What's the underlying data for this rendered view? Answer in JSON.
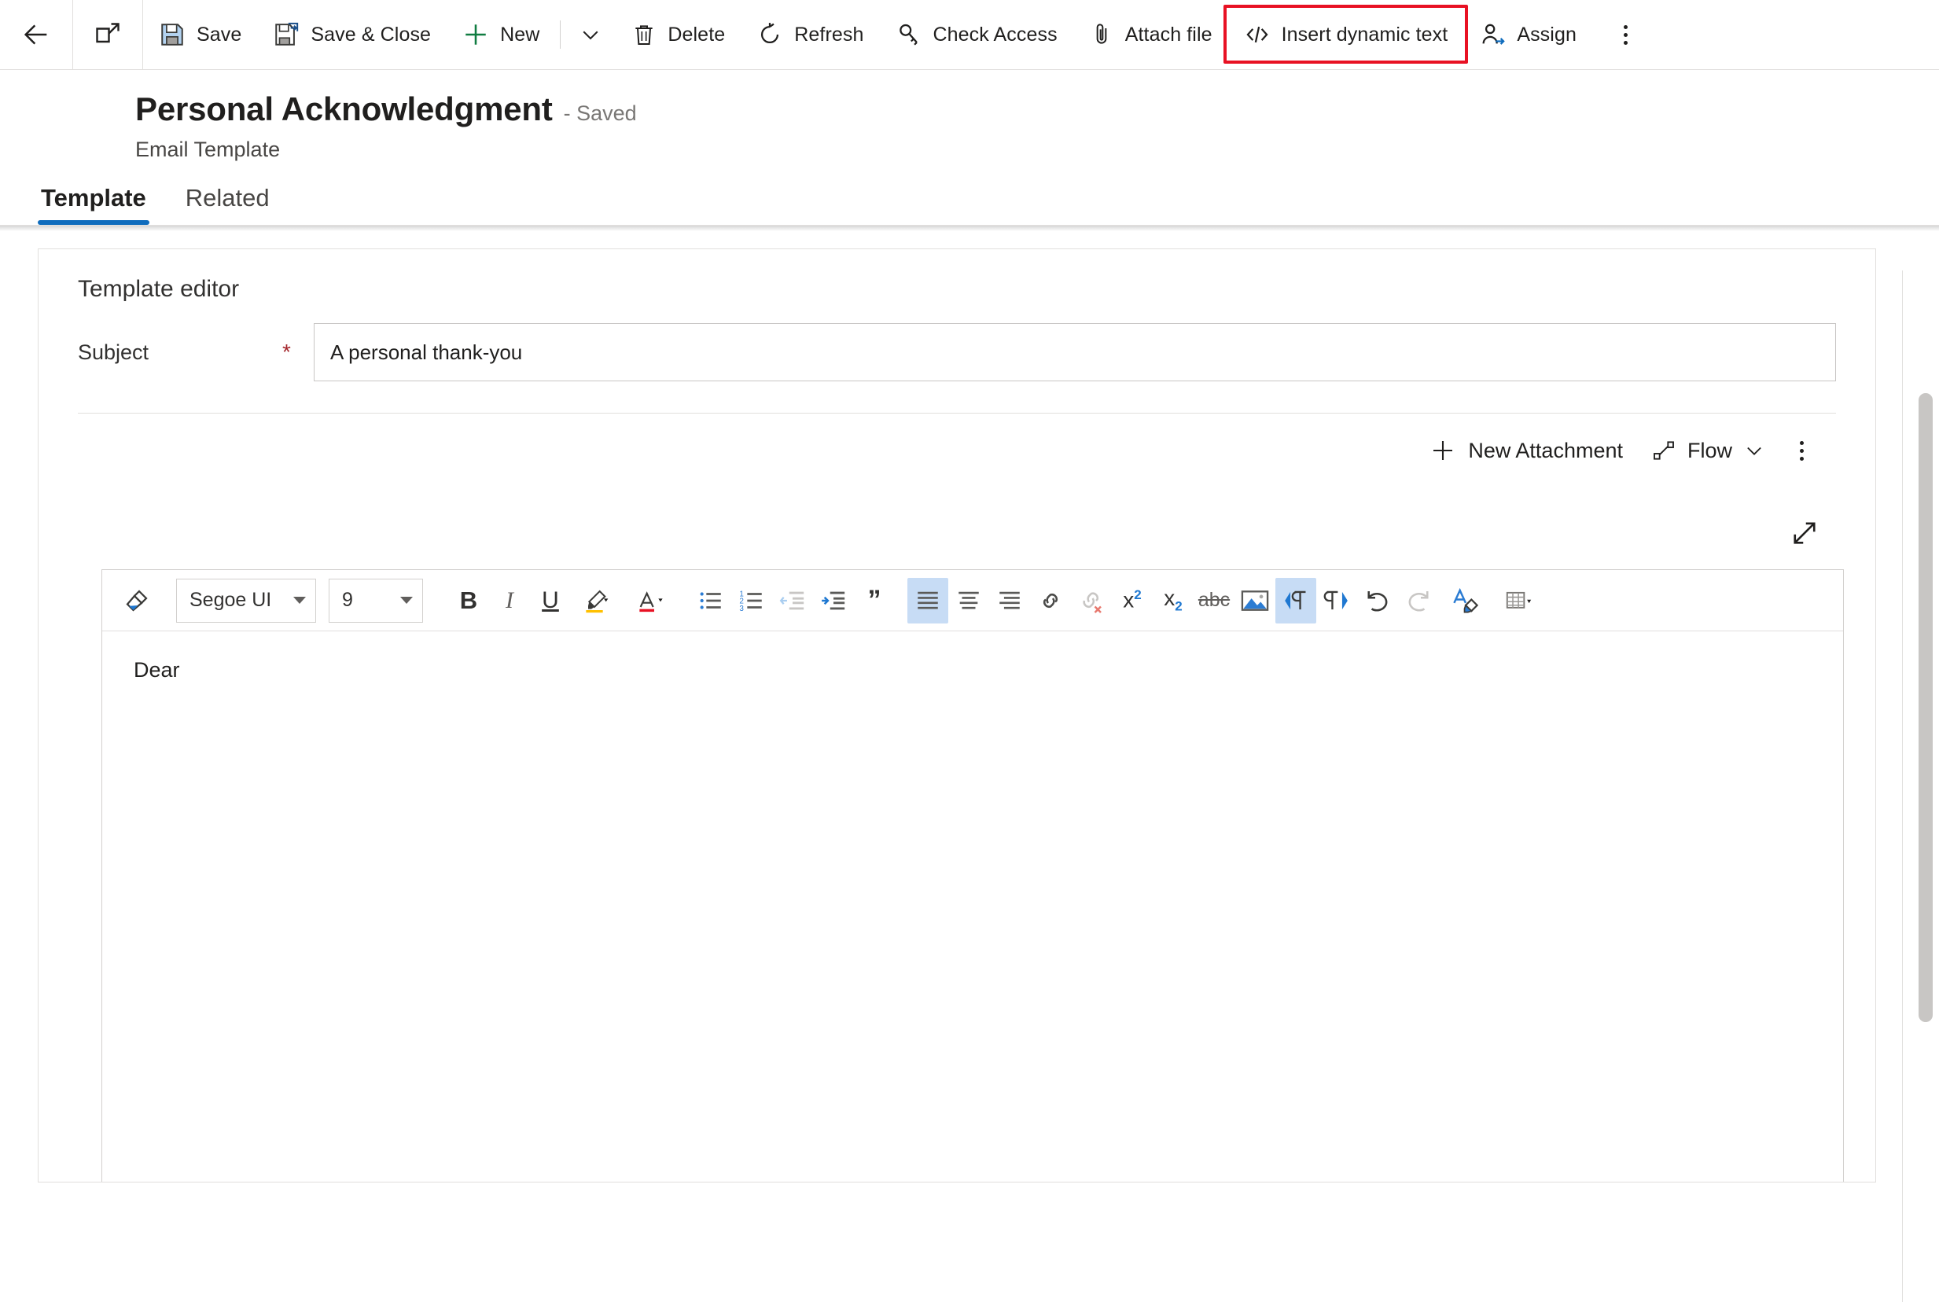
{
  "commandbar": {
    "back": {
      "label": "Back",
      "icon": "arrow-left-icon"
    },
    "popout": {
      "label": "Open in new window",
      "icon": "popout-icon"
    },
    "buttons": [
      {
        "id": "save",
        "label": "Save",
        "icon": "save-icon"
      },
      {
        "id": "save-close",
        "label": "Save & Close",
        "icon": "save-close-icon"
      },
      {
        "id": "new",
        "label": "New",
        "icon": "plus-icon"
      }
    ],
    "new_chevron": "chevron-down-icon",
    "buttons2": [
      {
        "id": "delete",
        "label": "Delete",
        "icon": "trash-icon"
      },
      {
        "id": "refresh",
        "label": "Refresh",
        "icon": "refresh-icon"
      },
      {
        "id": "check-access",
        "label": "Check Access",
        "icon": "key-icon"
      },
      {
        "id": "attach-file",
        "label": "Attach file",
        "icon": "paperclip-icon"
      },
      {
        "id": "insert-dynamic-text",
        "label": "Insert dynamic text",
        "icon": "code-icon"
      },
      {
        "id": "assign",
        "label": "Assign",
        "icon": "person-arrow-icon"
      }
    ],
    "overflow": "more-options-icon",
    "highlight_color": "#e81123",
    "highlighted_button": "Insert dynamic text"
  },
  "header": {
    "title": "Personal Acknowledgment",
    "status": "- Saved",
    "entity": "Email Template"
  },
  "tabs": [
    {
      "id": "template",
      "label": "Template",
      "active": true
    },
    {
      "id": "related",
      "label": "Related",
      "active": false
    }
  ],
  "accent_color": "#0f6cbd",
  "form": {
    "section_title": "Template editor",
    "subject": {
      "label": "Subject",
      "required_marker": "*",
      "value": "A personal thank-you",
      "placeholder": ""
    }
  },
  "subgrid": {
    "new_attachment": {
      "label": "New Attachment",
      "icon": "plus-icon"
    },
    "flow": {
      "label": "Flow",
      "icon": "flow-icon",
      "chevron": "chevron-down-icon"
    },
    "overflow": "more-options-icon"
  },
  "editor": {
    "expand_icon": "expand-diagonal-icon",
    "toolbar": {
      "format_painter": {
        "name": "format-painter-icon",
        "title": "Format painter"
      },
      "font_family": {
        "value": "Segoe UI",
        "chevron": "chevron-down-icon"
      },
      "font_size": {
        "value": "9",
        "chevron": "chevron-down-icon"
      },
      "buttons": [
        {
          "id": "bold",
          "glyph": "B",
          "title": "Bold",
          "state": "normal"
        },
        {
          "id": "italic",
          "glyph": "I",
          "title": "Italic",
          "state": "normal"
        },
        {
          "id": "underline",
          "glyph": "U",
          "title": "Underline",
          "state": "normal"
        },
        {
          "id": "highlight",
          "glyph": "",
          "title": "Highlight",
          "state": "normal",
          "color": "#ffc000"
        },
        {
          "id": "font-color",
          "glyph": "A",
          "title": "Font color",
          "state": "normal",
          "color": "#e81123"
        },
        {
          "id": "bulleted-list",
          "glyph": "",
          "title": "Bulleted list",
          "state": "normal"
        },
        {
          "id": "numbered-list",
          "glyph": "",
          "title": "Numbered list",
          "state": "normal"
        },
        {
          "id": "decrease-indent",
          "glyph": "",
          "title": "Decrease indent",
          "state": "disabled"
        },
        {
          "id": "increase-indent",
          "glyph": "",
          "title": "Increase indent",
          "state": "normal"
        },
        {
          "id": "blockquote",
          "glyph": "”",
          "title": "Block quote",
          "state": "normal"
        },
        {
          "id": "align-left",
          "glyph": "",
          "title": "Align left",
          "state": "active"
        },
        {
          "id": "align-center",
          "glyph": "",
          "title": "Align center",
          "state": "normal"
        },
        {
          "id": "align-right",
          "glyph": "",
          "title": "Align right",
          "state": "normal"
        },
        {
          "id": "link",
          "glyph": "",
          "title": "Insert link",
          "state": "normal"
        },
        {
          "id": "unlink",
          "glyph": "",
          "title": "Remove link",
          "state": "disabled"
        },
        {
          "id": "superscript",
          "glyph": "x²",
          "title": "Superscript",
          "state": "normal"
        },
        {
          "id": "subscript",
          "glyph": "x₂",
          "title": "Subscript",
          "state": "normal"
        },
        {
          "id": "strikethrough",
          "glyph": "abc",
          "title": "Strikethrough",
          "state": "normal"
        },
        {
          "id": "insert-image",
          "glyph": "",
          "title": "Insert image",
          "state": "normal"
        },
        {
          "id": "ltr",
          "glyph": "",
          "title": "Left to right",
          "state": "active"
        },
        {
          "id": "rtl",
          "glyph": "",
          "title": "Right to left",
          "state": "normal"
        },
        {
          "id": "undo",
          "glyph": "",
          "title": "Undo",
          "state": "normal"
        },
        {
          "id": "redo",
          "glyph": "",
          "title": "Redo",
          "state": "disabled"
        },
        {
          "id": "clear-formatting",
          "glyph": "",
          "title": "Clear formatting",
          "state": "normal"
        },
        {
          "id": "insert-table",
          "glyph": "",
          "title": "Insert table",
          "state": "normal"
        }
      ]
    },
    "body_text": "Dear"
  }
}
